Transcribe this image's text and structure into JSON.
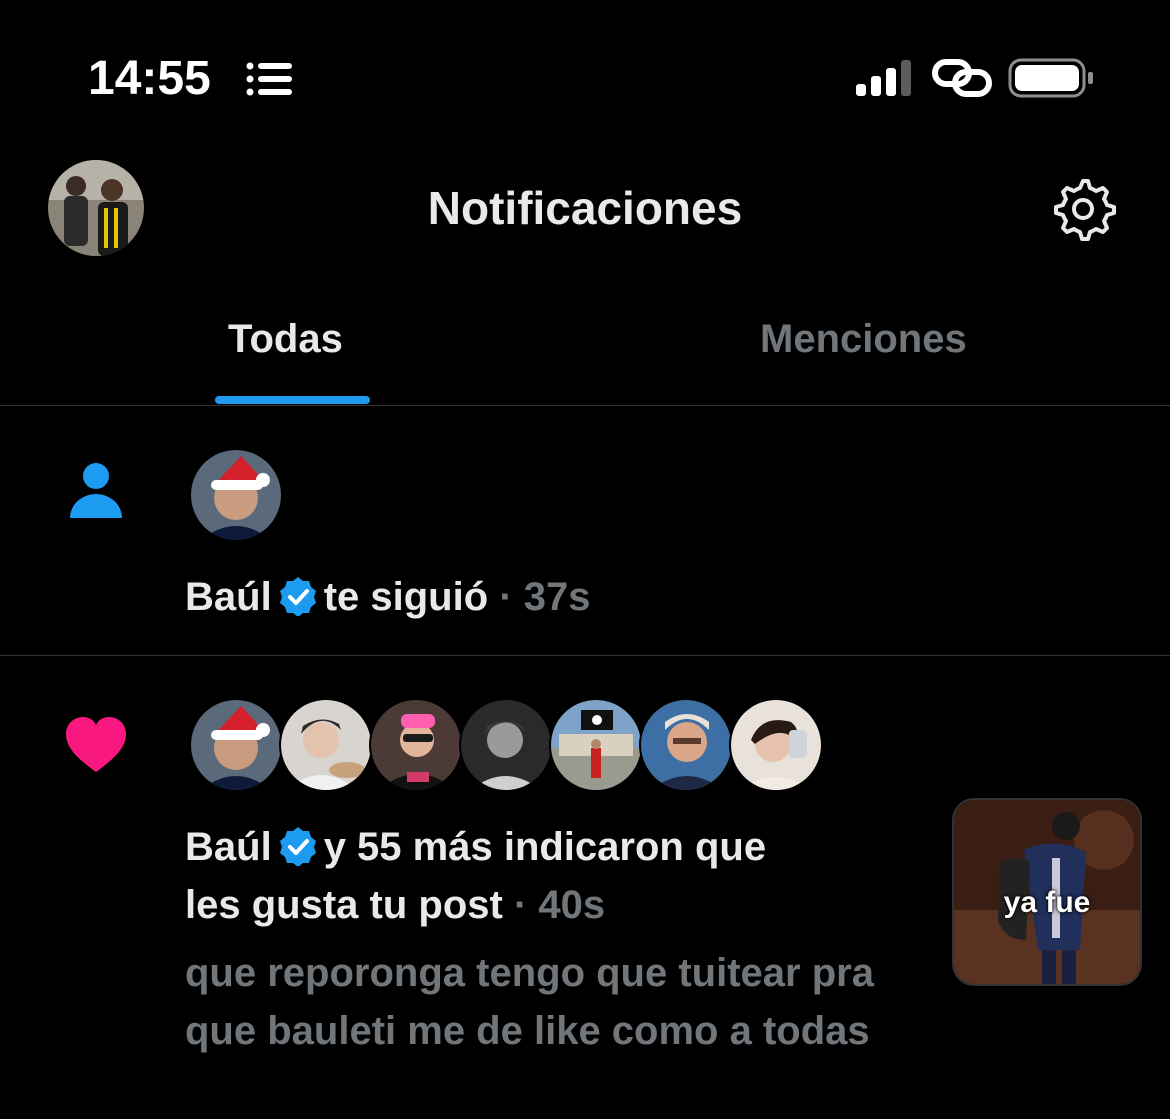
{
  "status_bar": {
    "time": "14:55",
    "icons": [
      "list-icon",
      "signal-icon",
      "hotspot-link-icon",
      "battery-icon"
    ]
  },
  "header": {
    "title": "Notificaciones",
    "avatar": "profile-avatar",
    "settings_icon": "gear-icon"
  },
  "tabs": [
    {
      "label": "Todas",
      "active": true
    },
    {
      "label": "Menciones",
      "active": false
    }
  ],
  "notifications": [
    {
      "type": "follow",
      "icon": "person-icon",
      "user": "Baúl",
      "verified": true,
      "action": "te siguió",
      "time": "· 37s"
    },
    {
      "type": "like",
      "icon": "heart-icon",
      "user": "Baúl",
      "verified": true,
      "action_line1": "y 55 más indicaron que",
      "action_line2": "les gusta tu post",
      "time": "· 40s",
      "post_text": "que reporonga tengo que tuitear pra que bauleti me de like como a todas",
      "thumbnail_caption": "ya fue",
      "avatar_count": 7
    }
  ],
  "colors": {
    "background": "#000000",
    "text": "#e7e9ea",
    "muted": "#71767b",
    "accent": "#1d9bf0",
    "like": "#f91880",
    "divider": "#2f3336"
  }
}
